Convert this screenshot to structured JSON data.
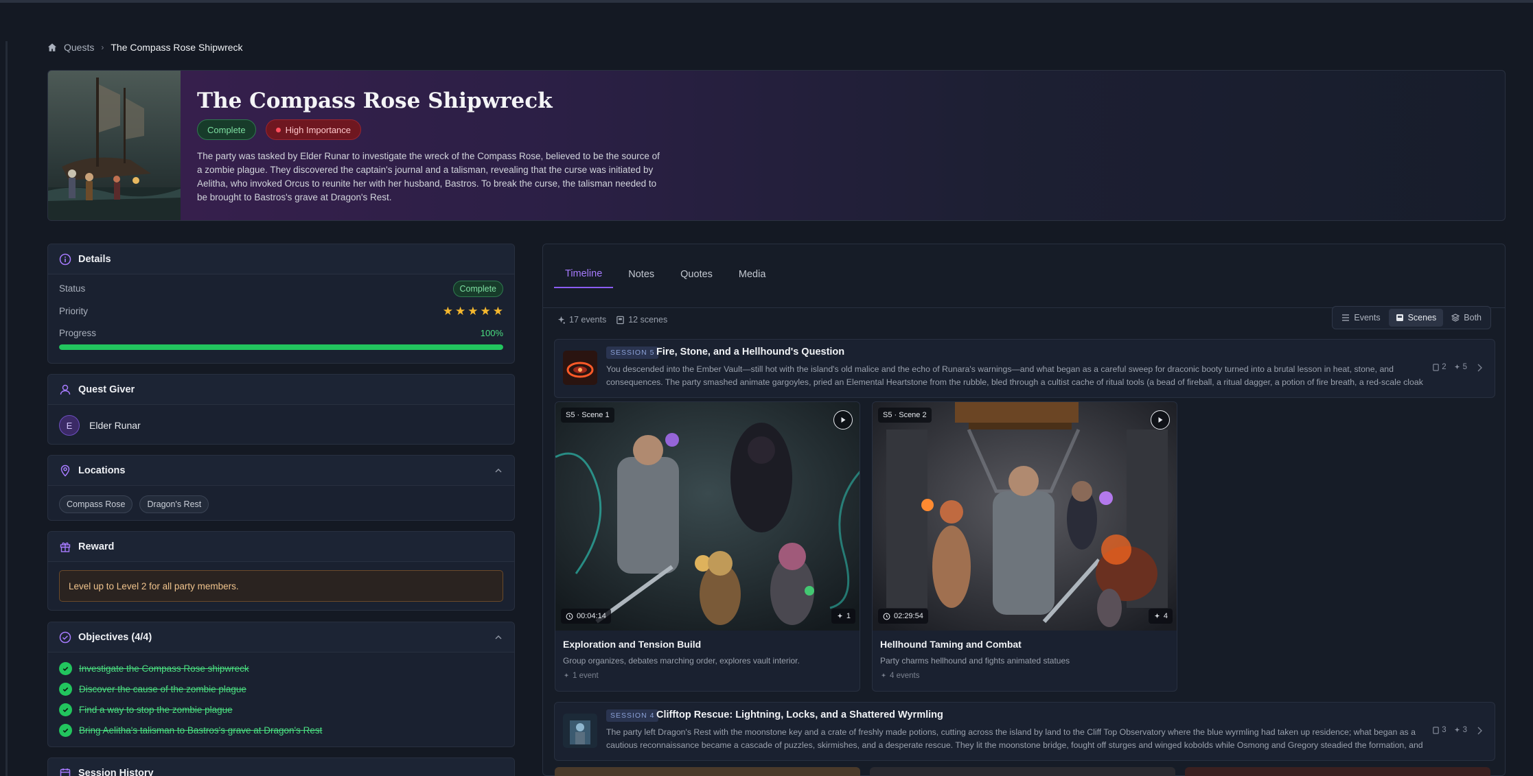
{
  "breadcrumb": {
    "home": "Quests",
    "current": "The Compass Rose Shipwreck"
  },
  "hero": {
    "title": "The Compass Rose Shipwreck",
    "status_badge": "Complete",
    "importance_badge": "High Importance",
    "description": "The party was tasked by Elder Runar to investigate the wreck of the Compass Rose, believed to be the source of a zombie plague. They discovered the captain's journal and a talisman, revealing that the curse was initiated by Aelitha, who invoked Orcus to reunite her with her husband, Bastros. To break the curse, the talisman needed to be brought to Bastros's grave at Dragon's Rest."
  },
  "details": {
    "title": "Details",
    "status_label": "Status",
    "status_value": "Complete",
    "priority_label": "Priority",
    "priority_stars": 5,
    "progress_label": "Progress",
    "progress_value": "100%",
    "progress_fraction": 1.0
  },
  "quest_giver": {
    "title": "Quest Giver",
    "avatar_letter": "E",
    "name": "Elder Runar"
  },
  "locations": {
    "title": "Locations",
    "items": [
      "Compass Rose",
      "Dragon's Rest"
    ]
  },
  "reward": {
    "title": "Reward",
    "text": "Level up to Level 2 for all party members."
  },
  "objectives": {
    "title": "Objectives (4/4)",
    "items": [
      "Investigate the Compass Rose shipwreck",
      "Discover the cause of the zombie plague",
      "Find a way to stop the zombie plague",
      "Bring Aelitha's talisman to Bastros's grave at Dragon's Rest"
    ]
  },
  "session_history": {
    "title": "Session History"
  },
  "tabs": [
    "Timeline",
    "Notes",
    "Quotes",
    "Media"
  ],
  "counts": {
    "events": "17 events",
    "scenes": "12 scenes"
  },
  "view_toggle": {
    "events": "Events",
    "scenes": "Scenes",
    "both": "Both"
  },
  "sessions": [
    {
      "tag": "SESSION 5",
      "title": "Fire, Stone, and a Hellhound's Question",
      "description": "You descended into the Ember Vault—still hot with the island's old malice and the echo of Runara's warnings—and what began as a careful sweep for draconic booty turned into a brutal lesson in heat, stone, and consequences. The party smashed animate gargoyles, pried an Elemental Heartstone from the rubble, bled through a cultist cache of ritual tools (a bead of fireball, a ritual dagger, a potion of fire breath, a red-scale cloak an...",
      "scenes_count": "2",
      "events_count": "5"
    },
    {
      "tag": "SESSION 4",
      "title": "Clifftop Rescue: Lightning, Locks, and a Shattered Wyrmling",
      "description": "The party left Dragon's Rest with the moonstone key and a crate of freshly made potions, cutting across the island by land to the Cliff Top Observatory where the blue wyrmling had taken up residence; what began as a cautious reconnaissance became a cascade of puzzles, skirmishes, and a desperate rescue. They lit the moonstone bridge, fought off sturges and winged kobolds while Osmong and Gregory steadied the formation, and Pila'...",
      "scenes_count": "3",
      "events_count": "3"
    }
  ],
  "scenes": [
    {
      "tag": "S5 · Scene 1",
      "duration": "00:04:14",
      "events": "1",
      "title": "Exploration and Tension Build",
      "description": "Group organizes, debates marching order, explores vault interior.",
      "events_label": "1 event"
    },
    {
      "tag": "S5 · Scene 2",
      "duration": "02:29:54",
      "events": "4",
      "title": "Hellhound Taming and Combat",
      "description": "Party charms hellhound and fights animated statues",
      "events_label": "4 events"
    }
  ]
}
